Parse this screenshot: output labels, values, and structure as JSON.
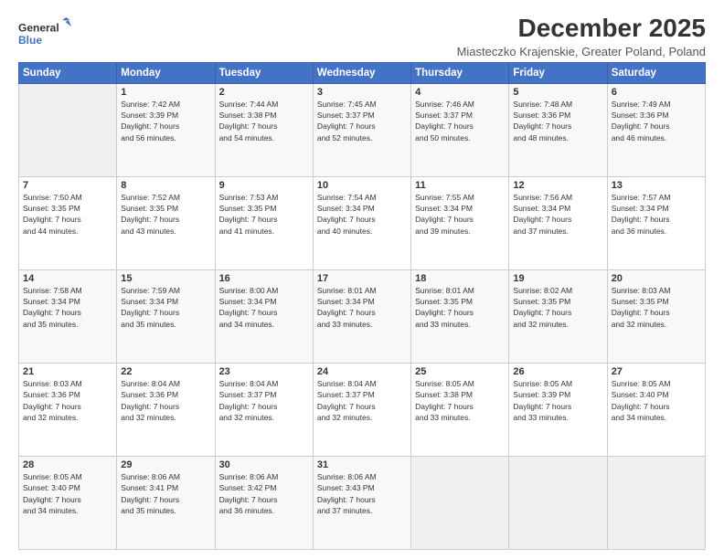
{
  "logo": {
    "line1": "General",
    "line2": "Blue"
  },
  "title": "December 2025",
  "location": "Miasteczko Krajenskie, Greater Poland, Poland",
  "days_of_week": [
    "Sunday",
    "Monday",
    "Tuesday",
    "Wednesday",
    "Thursday",
    "Friday",
    "Saturday"
  ],
  "weeks": [
    [
      {
        "day": "",
        "content": ""
      },
      {
        "day": "1",
        "content": "Sunrise: 7:42 AM\nSunset: 3:39 PM\nDaylight: 7 hours\nand 56 minutes."
      },
      {
        "day": "2",
        "content": "Sunrise: 7:44 AM\nSunset: 3:38 PM\nDaylight: 7 hours\nand 54 minutes."
      },
      {
        "day": "3",
        "content": "Sunrise: 7:45 AM\nSunset: 3:37 PM\nDaylight: 7 hours\nand 52 minutes."
      },
      {
        "day": "4",
        "content": "Sunrise: 7:46 AM\nSunset: 3:37 PM\nDaylight: 7 hours\nand 50 minutes."
      },
      {
        "day": "5",
        "content": "Sunrise: 7:48 AM\nSunset: 3:36 PM\nDaylight: 7 hours\nand 48 minutes."
      },
      {
        "day": "6",
        "content": "Sunrise: 7:49 AM\nSunset: 3:36 PM\nDaylight: 7 hours\nand 46 minutes."
      }
    ],
    [
      {
        "day": "7",
        "content": "Sunrise: 7:50 AM\nSunset: 3:35 PM\nDaylight: 7 hours\nand 44 minutes."
      },
      {
        "day": "8",
        "content": "Sunrise: 7:52 AM\nSunset: 3:35 PM\nDaylight: 7 hours\nand 43 minutes."
      },
      {
        "day": "9",
        "content": "Sunrise: 7:53 AM\nSunset: 3:35 PM\nDaylight: 7 hours\nand 41 minutes."
      },
      {
        "day": "10",
        "content": "Sunrise: 7:54 AM\nSunset: 3:34 PM\nDaylight: 7 hours\nand 40 minutes."
      },
      {
        "day": "11",
        "content": "Sunrise: 7:55 AM\nSunset: 3:34 PM\nDaylight: 7 hours\nand 39 minutes."
      },
      {
        "day": "12",
        "content": "Sunrise: 7:56 AM\nSunset: 3:34 PM\nDaylight: 7 hours\nand 37 minutes."
      },
      {
        "day": "13",
        "content": "Sunrise: 7:57 AM\nSunset: 3:34 PM\nDaylight: 7 hours\nand 36 minutes."
      }
    ],
    [
      {
        "day": "14",
        "content": "Sunrise: 7:58 AM\nSunset: 3:34 PM\nDaylight: 7 hours\nand 35 minutes."
      },
      {
        "day": "15",
        "content": "Sunrise: 7:59 AM\nSunset: 3:34 PM\nDaylight: 7 hours\nand 35 minutes."
      },
      {
        "day": "16",
        "content": "Sunrise: 8:00 AM\nSunset: 3:34 PM\nDaylight: 7 hours\nand 34 minutes."
      },
      {
        "day": "17",
        "content": "Sunrise: 8:01 AM\nSunset: 3:34 PM\nDaylight: 7 hours\nand 33 minutes."
      },
      {
        "day": "18",
        "content": "Sunrise: 8:01 AM\nSunset: 3:35 PM\nDaylight: 7 hours\nand 33 minutes."
      },
      {
        "day": "19",
        "content": "Sunrise: 8:02 AM\nSunset: 3:35 PM\nDaylight: 7 hours\nand 32 minutes."
      },
      {
        "day": "20",
        "content": "Sunrise: 8:03 AM\nSunset: 3:35 PM\nDaylight: 7 hours\nand 32 minutes."
      }
    ],
    [
      {
        "day": "21",
        "content": "Sunrise: 8:03 AM\nSunset: 3:36 PM\nDaylight: 7 hours\nand 32 minutes."
      },
      {
        "day": "22",
        "content": "Sunrise: 8:04 AM\nSunset: 3:36 PM\nDaylight: 7 hours\nand 32 minutes."
      },
      {
        "day": "23",
        "content": "Sunrise: 8:04 AM\nSunset: 3:37 PM\nDaylight: 7 hours\nand 32 minutes."
      },
      {
        "day": "24",
        "content": "Sunrise: 8:04 AM\nSunset: 3:37 PM\nDaylight: 7 hours\nand 32 minutes."
      },
      {
        "day": "25",
        "content": "Sunrise: 8:05 AM\nSunset: 3:38 PM\nDaylight: 7 hours\nand 33 minutes."
      },
      {
        "day": "26",
        "content": "Sunrise: 8:05 AM\nSunset: 3:39 PM\nDaylight: 7 hours\nand 33 minutes."
      },
      {
        "day": "27",
        "content": "Sunrise: 8:05 AM\nSunset: 3:40 PM\nDaylight: 7 hours\nand 34 minutes."
      }
    ],
    [
      {
        "day": "28",
        "content": "Sunrise: 8:05 AM\nSunset: 3:40 PM\nDaylight: 7 hours\nand 34 minutes."
      },
      {
        "day": "29",
        "content": "Sunrise: 8:06 AM\nSunset: 3:41 PM\nDaylight: 7 hours\nand 35 minutes."
      },
      {
        "day": "30",
        "content": "Sunrise: 8:06 AM\nSunset: 3:42 PM\nDaylight: 7 hours\nand 36 minutes."
      },
      {
        "day": "31",
        "content": "Sunrise: 8:06 AM\nSunset: 3:43 PM\nDaylight: 7 hours\nand 37 minutes."
      },
      {
        "day": "",
        "content": ""
      },
      {
        "day": "",
        "content": ""
      },
      {
        "day": "",
        "content": ""
      }
    ]
  ]
}
